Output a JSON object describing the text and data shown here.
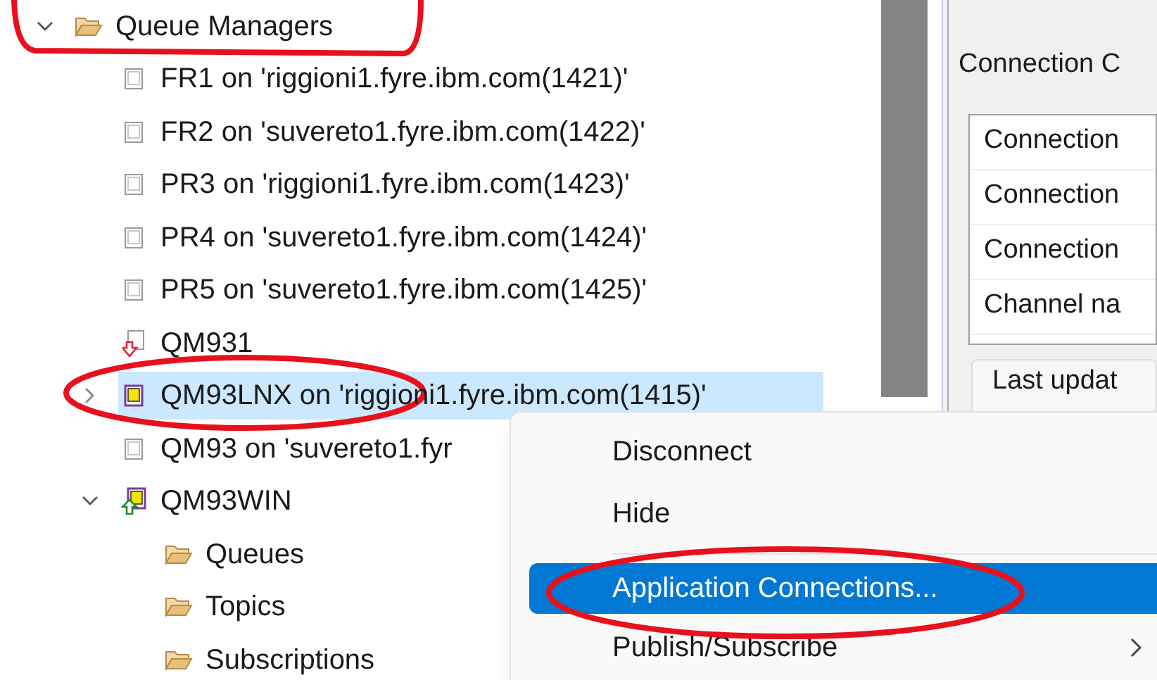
{
  "tree": [
    {
      "label": "Queue Managers",
      "kind": "folder",
      "expanded": true,
      "selected": false,
      "children": [
        {
          "label": "FR1 on 'riggioni1.fyre.ibm.com(1421)'",
          "kind": "stopped",
          "selected": false
        },
        {
          "label": "FR2 on 'suvereto1.fyre.ibm.com(1422)'",
          "kind": "stopped",
          "selected": false
        },
        {
          "label": "PR3 on 'riggioni1.fyre.ibm.com(1423)'",
          "kind": "stopped",
          "selected": false
        },
        {
          "label": "PR4 on 'suvereto1.fyre.ibm.com(1424)'",
          "kind": "stopped",
          "selected": false
        },
        {
          "label": "PR5 on 'suvereto1.fyre.ibm.com(1425)'",
          "kind": "stopped",
          "selected": false
        },
        {
          "label": "QM931",
          "kind": "down",
          "selected": false
        },
        {
          "label": "QM93LNX on 'riggioni1.fyre.ibm.com(1415)'",
          "kind": "running",
          "expanded": false,
          "selected": true
        },
        {
          "label": "QM93 on 'suvereto1.fyr",
          "kind": "stopped",
          "selected": false
        },
        {
          "label": "QM93WIN",
          "kind": "up",
          "expanded": true,
          "selected": false,
          "children": [
            {
              "label": "Queues",
              "kind": "folder",
              "selected": false
            },
            {
              "label": "Topics",
              "kind": "folder",
              "selected": false
            },
            {
              "label": "Subscriptions",
              "kind": "folder",
              "selected": false
            }
          ]
        }
      ]
    }
  ],
  "panel": {
    "title": "Connection C",
    "rows": [
      "Connection",
      "Connection",
      "Connection",
      "Channel na"
    ],
    "button": "Last updat"
  },
  "context_menu": [
    {
      "kind": "item",
      "label": "Disconnect",
      "selected": false
    },
    {
      "kind": "item",
      "label": "Hide",
      "selected": false
    },
    {
      "kind": "separator"
    },
    {
      "kind": "item",
      "label": "Application Connections...",
      "selected": true
    },
    {
      "kind": "submenu",
      "label": "Publish/Subscribe",
      "selected": false
    }
  ]
}
